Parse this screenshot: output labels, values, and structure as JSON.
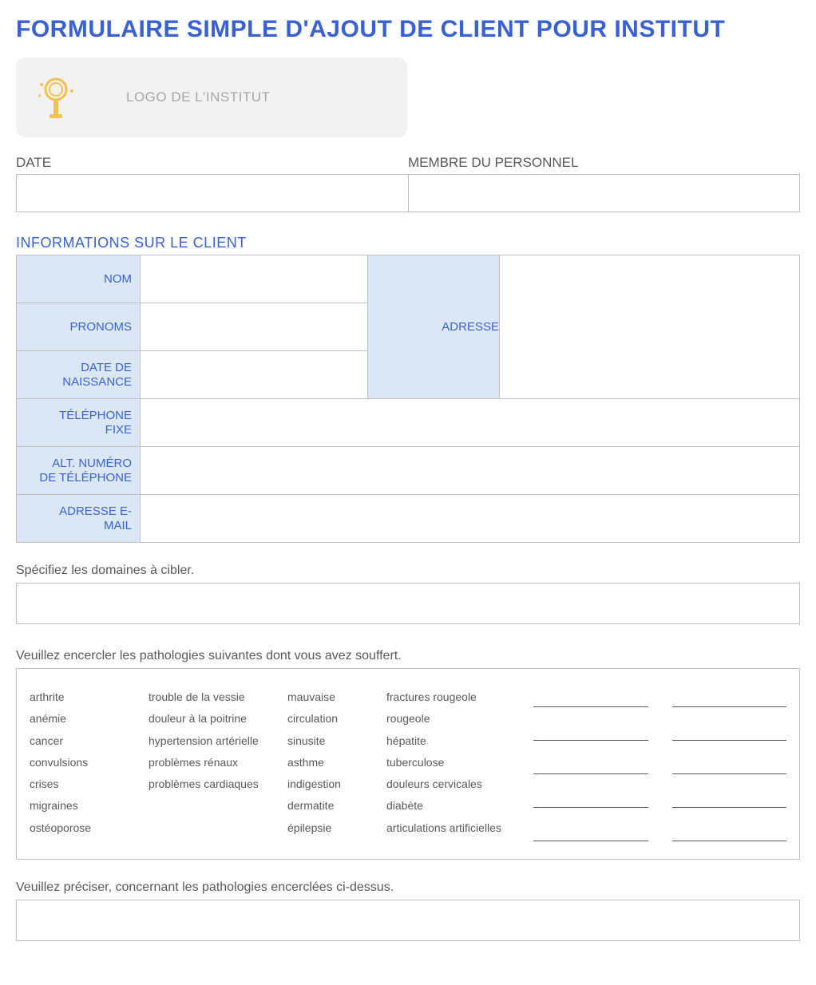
{
  "title": "FORMULAIRE SIMPLE D'AJOUT DE CLIENT POUR INSTITUT",
  "logo_placeholder": "LOGO DE L'INSTITUT",
  "date_label": "DATE",
  "staff_label": "MEMBRE DU PERSONNEL",
  "date_value": "",
  "staff_value": "",
  "client_section": "INFORMATIONS SUR LE CLIENT",
  "fields": {
    "nom": {
      "label": "NOM",
      "value": ""
    },
    "pronoms": {
      "label": "PRONOMS",
      "value": ""
    },
    "naissance": {
      "label_l1": "DATE DE",
      "label_l2": "NAISSANCE",
      "value": ""
    },
    "adresse": {
      "label": "ADRESSE",
      "value": ""
    },
    "tel_fixe": {
      "label_l1": "TÉLÉPHONE",
      "label_l2": "FIXE",
      "value": ""
    },
    "tel_alt": {
      "label_l1": "ALT. NUMÉRO",
      "label_l2": "DE TÉLÉPHONE",
      "value": ""
    },
    "email": {
      "label_l1": "ADRESSE E-",
      "label_l2": "MAIL",
      "value": ""
    }
  },
  "prompt_domains": "Spécifiez les domaines à cibler.",
  "domains_value": "",
  "prompt_pathologies": "Veuillez encercler les pathologies suivantes dont vous avez souffert.",
  "pathologies": {
    "col1": [
      "arthrite",
      "anémie",
      "cancer",
      "convulsions",
      "crises",
      "migraines",
      "ostéoporose"
    ],
    "col2": [
      "trouble de la vessie",
      "douleur à la poitrine",
      " hypertension artérielle",
      "problèmes rénaux",
      "problèmes cardiaques"
    ],
    "col3": [
      "mauvaise circulation",
      "sinusite",
      "asthme",
      "indigestion",
      "dermatite",
      "épilepsie"
    ],
    "col4": [
      "fractures rougeole",
      "rougeole",
      "hépatite",
      " tuberculose",
      "douleurs cervicales",
      "diabète",
      "articulations artificielles"
    ]
  },
  "prompt_precisions": "Veuillez préciser, concernant les pathologies encerclées ci-dessus.",
  "precisions_value": ""
}
